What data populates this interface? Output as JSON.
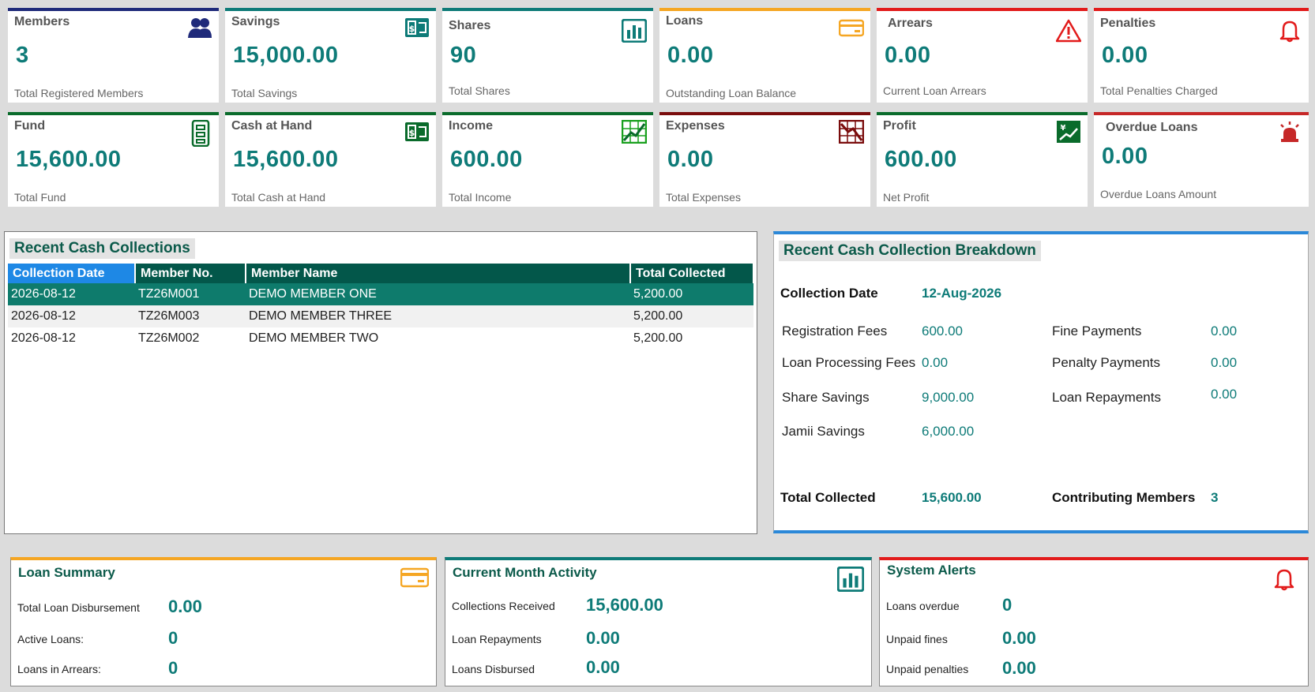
{
  "kpis_row1": [
    {
      "title": "Members",
      "value": "3",
      "sub": "Total Registered Members",
      "icon": "members-icon",
      "color": "#1f2a7a"
    },
    {
      "title": "Savings",
      "value": "15,000.00",
      "sub": "Total Savings",
      "icon": "money-icon",
      "color": "#0e7b78"
    },
    {
      "title": "Shares",
      "value": "90",
      "sub": "Total Shares",
      "icon": "bar-chart-icon",
      "color": "#0e7b78"
    },
    {
      "title": "Loans",
      "value": "0.00",
      "sub": "Outstanding Loan Balance",
      "icon": "credit-card-icon",
      "color": "#f5a623"
    },
    {
      "title": "Arrears",
      "value": "0.00",
      "sub": "Current Loan Arrears",
      "icon": "warning-icon",
      "color": "#e21b1b"
    },
    {
      "title": "Penalties",
      "value": "0.00",
      "sub": "Total Penalties Charged",
      "icon": "bell-icon",
      "color": "#e21b1b"
    }
  ],
  "kpis_row2": [
    {
      "title": "Fund",
      "value": "15,600.00",
      "sub": "Total Fund",
      "icon": "cabinet-icon",
      "color": "#0a6b2b"
    },
    {
      "title": "Cash at Hand",
      "value": "15,600.00",
      "sub": "Total Cash at Hand",
      "icon": "cash-icon",
      "color": "#0a6b2b"
    },
    {
      "title": "Income",
      "value": "600.00",
      "sub": "Total Income",
      "icon": "line-chart-icon",
      "color": "#0a6b2b"
    },
    {
      "title": "Expenses",
      "value": "0.00",
      "sub": "Total Expenses",
      "icon": "down-chart-icon",
      "color": "#7a0c0c"
    },
    {
      "title": "Profit",
      "value": "600.00",
      "sub": "Net Profit",
      "icon": "profit-icon",
      "color": "#0a6b2b"
    },
    {
      "title": "Overdue Loans",
      "value": "0.00",
      "sub": "Overdue Loans Amount",
      "icon": "siren-icon",
      "color": "#c62828"
    }
  ],
  "collections": {
    "title": "Recent Cash Collections",
    "columns": [
      "Collection Date",
      "Member No.",
      "Member Name",
      "Total Collected"
    ],
    "rows": [
      [
        "2026-08-12",
        "TZ26M001",
        "DEMO MEMBER ONE",
        "5,200.00"
      ],
      [
        "2026-08-12",
        "TZ26M003",
        "DEMO MEMBER THREE",
        "5,200.00"
      ],
      [
        "2026-08-12",
        "TZ26M002",
        "DEMO MEMBER TWO",
        "5,200.00"
      ]
    ]
  },
  "breakdown": {
    "title": "Recent Cash Collection Breakdown",
    "date_label": "Collection Date",
    "date_value": "12-Aug-2026",
    "left": [
      {
        "label": "Registration Fees",
        "value": "600.00"
      },
      {
        "label": "Loan Processing Fees",
        "value": "0.00"
      },
      {
        "label": "Share Savings",
        "value": "9,000.00"
      },
      {
        "label": "Jamii Savings",
        "value": "6,000.00"
      }
    ],
    "right": [
      {
        "label": "Fine Payments",
        "value": "0.00"
      },
      {
        "label": "Penalty Payments",
        "value": "0.00"
      },
      {
        "label": "Loan Repayments",
        "value": "0.00"
      }
    ],
    "total_label": "Total Collected",
    "total_value": "15,600.00",
    "members_label": "Contributing Members",
    "members_value": "3"
  },
  "loan_summary": {
    "title": "Loan Summary",
    "rows": [
      {
        "label": "Total Loan Disbursement",
        "value": "0.00"
      },
      {
        "label": "Active Loans:",
        "value": "0"
      },
      {
        "label": "Loans in Arrears:",
        "value": "0"
      }
    ]
  },
  "month_activity": {
    "title": "Current Month Activity",
    "rows": [
      {
        "label": "Collections Received",
        "value": "15,600.00"
      },
      {
        "label": "Loan Repayments",
        "value": "0.00"
      },
      {
        "label": "Loans Disbursed",
        "value": "0.00"
      }
    ]
  },
  "system_alerts": {
    "title": "System Alerts",
    "rows": [
      {
        "label": "Loans overdue",
        "value": "0"
      },
      {
        "label": "Unpaid fines",
        "value": "0.00"
      },
      {
        "label": "Unpaid penalties",
        "value": "0.00"
      }
    ]
  }
}
